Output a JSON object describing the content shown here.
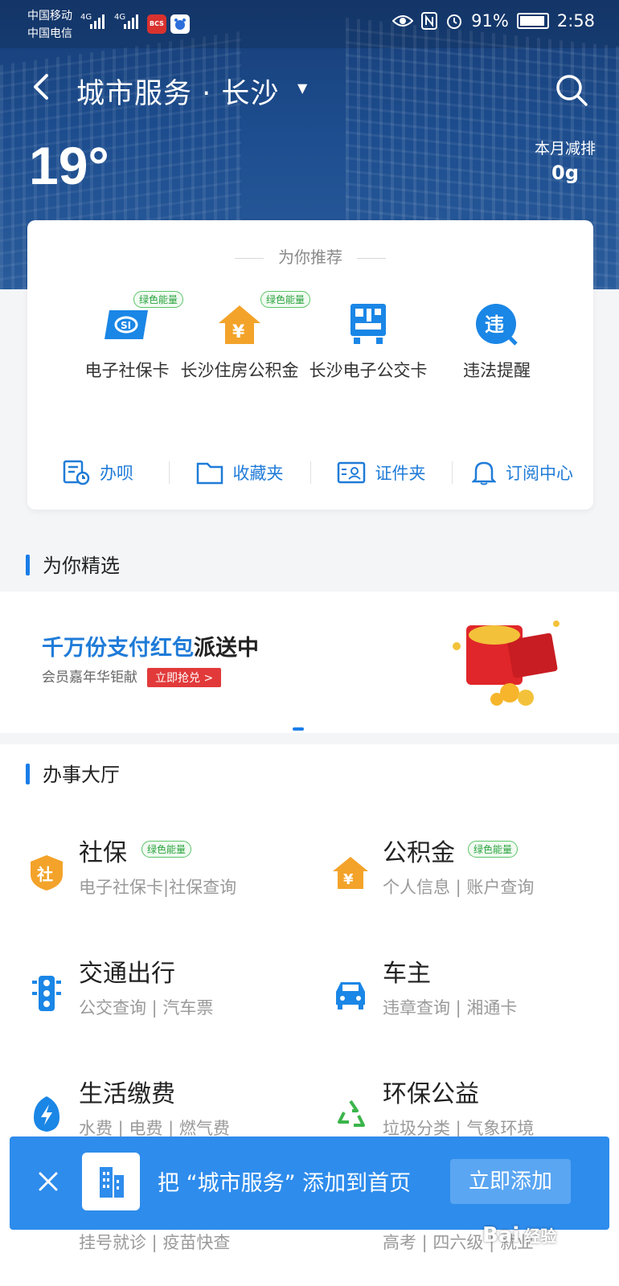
{
  "status_bar": {
    "carrier_1": "中国移动",
    "carrier_2": "中国电信",
    "net_1": "4G",
    "net_2": "4G",
    "app_icon_1": "BCS",
    "battery_percent": "91%",
    "time": "2:58"
  },
  "header": {
    "title": "城市服务 · 长沙",
    "temperature": "19°",
    "emission_label": "本月减排",
    "emission_value": "0g"
  },
  "recommend": {
    "title": "为你推荐",
    "items": [
      {
        "label": "电子社保卡",
        "badge": "绿色能量",
        "icon": "social-security-card-icon"
      },
      {
        "label": "长沙住房公积金",
        "badge": "绿色能量",
        "icon": "housing-fund-icon"
      },
      {
        "label": "长沙电子公交卡",
        "badge": "",
        "icon": "bus-card-icon"
      },
      {
        "label": "违法提醒",
        "badge": "",
        "icon": "violation-icon"
      }
    ],
    "tools": [
      {
        "label": "办呗",
        "icon": "ban-bei-icon"
      },
      {
        "label": "收藏夹",
        "icon": "folder-icon"
      },
      {
        "label": "证件夹",
        "icon": "id-card-icon"
      },
      {
        "label": "订阅中心",
        "icon": "bell-icon"
      }
    ]
  },
  "featured": {
    "title": "为你精选",
    "banner_line1_blue": "千万份支付红包",
    "banner_line1_black": "派送中",
    "banner_line2": "会员嘉年华钜献",
    "banner_button": "立即抢兑 >"
  },
  "hall": {
    "title": "办事大厅",
    "services": [
      {
        "name": "社保",
        "badge": "绿色能量",
        "sub": "电子社保卡|社保查询",
        "icon": "shield-icon"
      },
      {
        "name": "公积金",
        "badge": "绿色能量",
        "sub": "个人信息 | 账户查询",
        "icon": "house-yuan-icon"
      },
      {
        "name": "交通出行",
        "badge": "",
        "sub": "公交查询 | 汽车票",
        "icon": "traffic-light-icon"
      },
      {
        "name": "车主",
        "badge": "",
        "sub": "违章查询 | 湘通卡",
        "icon": "car-icon"
      },
      {
        "name": "生活缴费",
        "badge": "",
        "sub": "水费 | 电费 | 燃气费",
        "icon": "lightning-icon"
      },
      {
        "name": "环保公益",
        "badge": "",
        "sub": "垃圾分类 | 气象环境",
        "icon": "recycle-icon"
      },
      {
        "name": "",
        "badge": "",
        "sub": "挂号就诊 | 疫苗快查",
        "icon": "medical-icon"
      },
      {
        "name": "",
        "badge": "",
        "sub": "高考 | 四六级 | 就业",
        "icon": "education-icon"
      }
    ]
  },
  "add_bar": {
    "message": "把 “城市服务” 添加到首页",
    "button": "立即添加"
  },
  "watermark": {
    "text": "Bai",
    "suffix": "经验"
  }
}
